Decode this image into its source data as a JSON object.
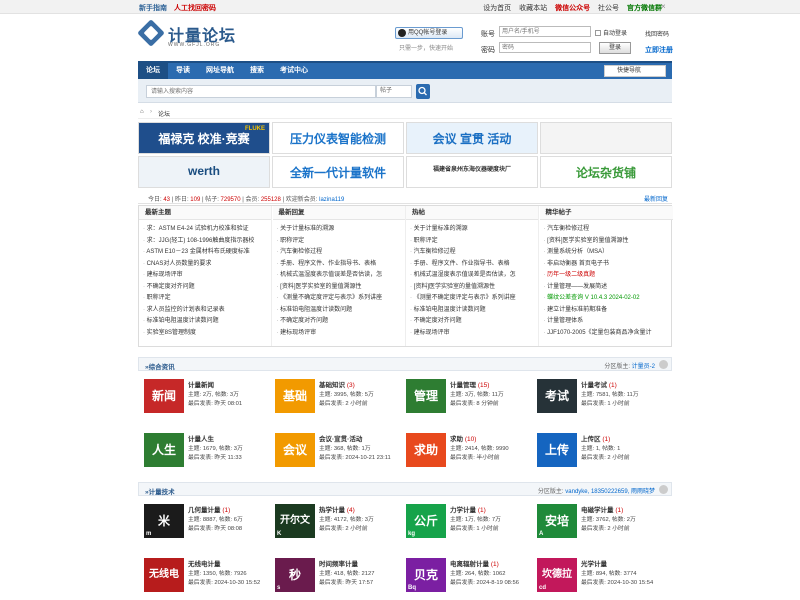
{
  "topbar": {
    "left": [
      "新手指南",
      "人工找回密码"
    ],
    "right": [
      "设为首页",
      "收藏本站",
      "微信公众号",
      "社公号",
      "官方微信群"
    ],
    "right_red_index": 2,
    "right_green_index": 4,
    "close": "×"
  },
  "header": {
    "logo_title": "计量论坛",
    "logo_sub": "WWW.GFJL.ORG",
    "qq_button": "用QQ帐号登录",
    "qq_tip": "只需一步，快速开始"
  },
  "login": {
    "account_label": "账号",
    "account_placeholder": "用户名/手机号",
    "auto_login": "自动登录",
    "forgot": "找回密码",
    "password_label": "密码",
    "password_placeholder": "密码",
    "login_button": "登录",
    "register": "立即注册"
  },
  "nav": {
    "items": [
      "论坛",
      "导读",
      "网址导航",
      "搜索",
      "考试中心"
    ],
    "quick": "快捷导航"
  },
  "search": {
    "placeholder": "请输入搜索内容",
    "select": "帖子"
  },
  "breadcrumb": {
    "home": "⌂",
    "sep": "›",
    "current": "论坛"
  },
  "ads": [
    {
      "text": "福禄克 校准·竞赛",
      "sub": "FLUKE",
      "bg": "#1f4e8c",
      "fg": "#fff"
    },
    {
      "text": "压力仪表智能检测",
      "sub": "",
      "bg": "#ffffff",
      "fg": "#1a73c9"
    },
    {
      "text": "会议 宣贯 活动",
      "sub": "",
      "bg": "#e8f2fb",
      "fg": "#1a6fc3"
    },
    {
      "text": "",
      "sub": "",
      "bg": "#f4f4f4",
      "fg": "#333"
    },
    {
      "text": "werth",
      "sub": "",
      "bg": "#eef3f8",
      "fg": "#1a4d80"
    },
    {
      "text": "全新一代计量软件",
      "sub": "",
      "bg": "#ffffff",
      "fg": "#1a73c9"
    },
    {
      "text": "福建省泉州东海仪器硬度块厂",
      "sub": "",
      "bg": "#ffffff",
      "fg": "#333"
    },
    {
      "text": "论坛杂货铺",
      "sub": "",
      "bg": "#ffffff",
      "fg": "#3a9a3a"
    }
  ],
  "stats": {
    "today_label": "今日:",
    "today": "43",
    "yesterday_label": "昨日:",
    "yesterday": "109",
    "posts_label": "帖子:",
    "posts": "729570",
    "members_label": "会员:",
    "members": "255128",
    "welcome": "欢迎新会员:",
    "newest": "lazina119",
    "latest": "最新回复"
  },
  "hot": {
    "columns": [
      {
        "title": "最新主题",
        "items": [
          "求：ASTM E4-24 试验机力校准和验证",
          "求：JJG(轻工) 108-1996触曲度指示器校",
          "ASTM E10－23 金属材料布氏硬度标准",
          "CNAS对人员数量的要求",
          "建标现场评审",
          "不确定度对齐问题",
          "职称评定",
          "求人员监控的计划表和记录表",
          "标准铂电阻温度计读数问题",
          "实验室8S管理制度"
        ]
      },
      {
        "title": "最新回复",
        "items": [
          "关于计量标准的溯源",
          "职称评定",
          "汽车衡检修过程",
          "手册、程序文件、作业指导书、表格",
          "机械式温湿度表示值误差是否估读，怎",
          "[资料]医学实验室的量值溯源性",
          "《测量不确定度评定与表示》系列讲座",
          "标准铂电阻温度计读数问题",
          "不确定度对齐问题",
          "建标现场评审"
        ]
      },
      {
        "title": "热帖",
        "items": [
          "关于计量标准的溯源",
          "职称评定",
          "汽车衡检修过程",
          "手册、程序文件、作业指导书、表格",
          "机械式温湿度表示值误差是否估读，怎",
          "[资料]医学实验室的量值溯源性",
          "《测量不确定度评定与表示》系列讲座",
          "标准铂电阻温度计读数问题",
          "不确定度对齐问题",
          "建标现场评审"
        ]
      },
      {
        "title": "精华帖子",
        "items": [
          "汽车衡检修过程",
          "[资料]医学实验室的量值溯源性",
          "测量系统分析（MSA）",
          "非启动衡器 首页电子书",
          "历年一级二级真题",
          "计量管理——发展简述",
          "蝶纹公差查询 V 10.4.3 2024-02-02",
          "建立计量标准前期准备",
          "计量管理体系",
          "JJF1070-2005《定量包装商品净含量计"
        ]
      }
    ],
    "red_item": {
      "col": 3,
      "index": 4
    },
    "green_item": {
      "col": 3,
      "index": 6
    }
  },
  "sections": [
    {
      "title": "»综合资讯",
      "mod_label": "分区版主:",
      "mods": "计量员-2",
      "forums": [
        {
          "icon": "新闻",
          "sub": "",
          "color": "#c62828",
          "name": "计量新闻",
          "count": "",
          "l1": "主题: 2万, 帖数: 3万",
          "l2": "最后发表: 昨天 08:01"
        },
        {
          "icon": "基础",
          "sub": "",
          "color": "#f29a00",
          "name": "基础知识",
          "count": "(3)",
          "l1": "主题: 3995, 帖数: 5万",
          "l2": "最后发表: 2 小时前"
        },
        {
          "icon": "管理",
          "sub": "",
          "color": "#2e7d32",
          "name": "计量管理",
          "count": "(15)",
          "l1": "主题: 3万, 帖数: 11万",
          "l2": "最后发表: 8 分钟前"
        },
        {
          "icon": "考试",
          "sub": "",
          "color": "#263238",
          "name": "计量考试",
          "count": "(1)",
          "l1": "主题: 7581, 帖数: 11万",
          "l2": "最后发表: 1 小时前"
        },
        {
          "icon": "人生",
          "sub": "",
          "color": "#2e7d32",
          "name": "计量人生",
          "count": "",
          "l1": "主题: 1679, 帖数: 3万",
          "l2": "最后发表: 昨天 11:33"
        },
        {
          "icon": "会议",
          "sub": "",
          "color": "#f29a00",
          "name": "会议·宣贯·活动",
          "count": "",
          "l1": "主题: 368, 帖数: 1万",
          "l2": "最后发表: 2024-10-21 23:11"
        },
        {
          "icon": "求助",
          "sub": "",
          "color": "#e8491d",
          "name": "求助",
          "count": "(10)",
          "l1": "主题: 2414, 帖数: 9990",
          "l2": "最后发表: 半小时前"
        },
        {
          "icon": "上传",
          "sub": "",
          "color": "#1565c0",
          "name": "上传区",
          "count": "(1)",
          "l1": "主题: 1, 帖数: 1",
          "l2": "最后发表: 2 小时前"
        }
      ]
    },
    {
      "title": "»计量技术",
      "mod_label": "分区版主:",
      "mods": "vandyke, 18350222659, 雨雨晓梦",
      "forums": [
        {
          "icon": "米",
          "sub": "m",
          "color": "#1b1b1b",
          "name": "几何量计量",
          "count": "(1)",
          "l1": "主题: 8887, 帖数: 6万",
          "l2": "最后发表: 昨天 08:08"
        },
        {
          "icon": "开尔文",
          "sub": "K",
          "color": "#1b3a20",
          "name": "热学计量",
          "count": "(4)",
          "l1": "主题: 4172, 帖数: 3万",
          "l2": "最后发表: 2 小时前"
        },
        {
          "icon": "公斤",
          "sub": "kg",
          "color": "#16a34a",
          "name": "力学计量",
          "count": "(1)",
          "l1": "主题: 1万, 帖数: 7万",
          "l2": "最后发表: 1 小时前"
        },
        {
          "icon": "安培",
          "sub": "A",
          "color": "#1f8a3a",
          "name": "电磁学计量",
          "count": "(1)",
          "l1": "主题: 3762, 帖数: 2万",
          "l2": "最后发表: 2 小时前"
        },
        {
          "icon": "无线电",
          "sub": "",
          "color": "#b71c1c",
          "name": "无线电计量",
          "count": "",
          "l1": "主题: 1350, 帖数: 7926",
          "l2": "最后发表: 2024-10-30 15:52"
        },
        {
          "icon": "秒",
          "sub": "s",
          "color": "#6a1b4d",
          "name": "时间频率计量",
          "count": "",
          "l1": "主题: 418, 帖数: 2127",
          "l2": "最后发表: 昨天 17:57"
        },
        {
          "icon": "贝克",
          "sub": "Bq",
          "color": "#7b1fa2",
          "name": "电离辐射计量",
          "count": "(1)",
          "l1": "主题: 264, 帖数: 1062",
          "l2": "最后发表: 2024-8-19 08:56"
        },
        {
          "icon": "坎德拉",
          "sub": "cd",
          "color": "#c2185b",
          "name": "光学计量",
          "count": "",
          "l1": "主题: 894, 帖数: 3774",
          "l2": "最后发表: 2024-10-30 15:54"
        }
      ]
    }
  ]
}
